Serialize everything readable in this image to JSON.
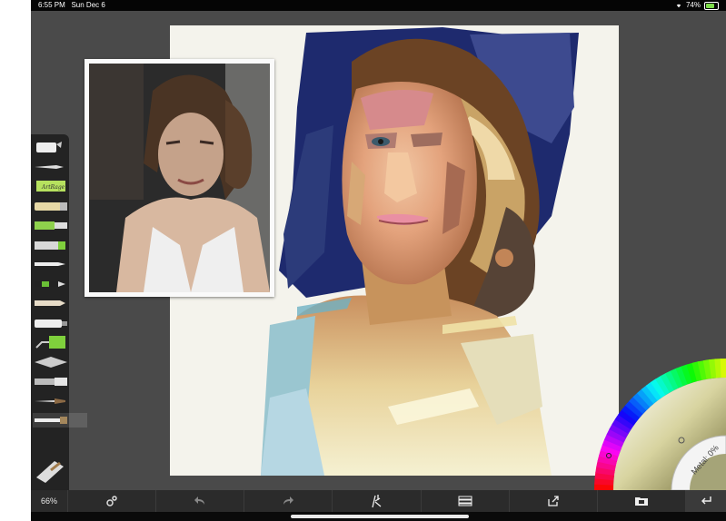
{
  "status_bar": {
    "time": "6:55 PM",
    "date": "Sun Dec 6",
    "battery": "74%",
    "battery_level": 0.74,
    "wifi_icon": "wifi-icon"
  },
  "toolbar": {
    "tools": [
      {
        "name": "paint-bucket-icon"
      },
      {
        "name": "airbrush-icon"
      },
      {
        "name": "sticker-icon",
        "label": "ArtRage"
      },
      {
        "name": "glitter-tube-icon"
      },
      {
        "name": "marker-icon"
      },
      {
        "name": "felt-pen-icon"
      },
      {
        "name": "inking-pen-icon"
      },
      {
        "name": "pencil-icon"
      },
      {
        "name": "chalk-icon"
      },
      {
        "name": "paint-tube-icon"
      },
      {
        "name": "paint-roller-icon"
      },
      {
        "name": "palette-knife-icon"
      },
      {
        "name": "paint-tube-2-icon"
      },
      {
        "name": "watercolor-brush-icon"
      },
      {
        "name": "oil-brush-icon"
      },
      {
        "name": "eraser-icon"
      }
    ],
    "selected_tool": "oil-brush-icon"
  },
  "bottom_bar": {
    "zoom": "66%",
    "icons": [
      "settings-icon",
      "undo-icon",
      "redo-icon",
      "brush-settings-icon",
      "layers-icon",
      "share-icon",
      "gallery-icon"
    ],
    "return_icon": "return-icon"
  },
  "color_picker": {
    "metal_label": "Metal: 0%",
    "current_color": "#a5a478"
  },
  "colors": {
    "ui_background": "#4a4a4a",
    "toolbar": "#232323",
    "canvas": "#f4f3ec"
  }
}
